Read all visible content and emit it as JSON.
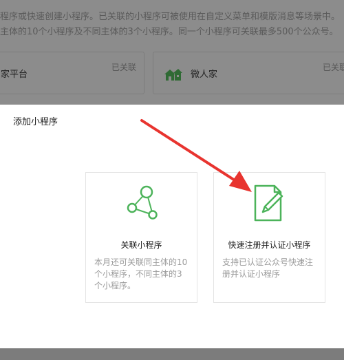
{
  "background": {
    "desc_line1": "程序或快速创建小程序。已关联的小程序可被使用在自定义菜单和模版消息等场景中。",
    "desc_line2": "主体的10个小程序及不同主体的3个小程序。同一个小程序可关联最多500个公众号。",
    "cards": [
      {
        "name": "家平台",
        "status": "已关联",
        "icon": "none"
      },
      {
        "name": "微人家",
        "status": "已关联",
        "icon": "house-icon"
      }
    ]
  },
  "dialog": {
    "title": "添加小程序",
    "options": [
      {
        "icon": "link-nodes-icon",
        "title": "关联小程序",
        "desc_lines": [
          "本月还可关联同主体的10",
          "个小程序，不同主体的3",
          "个小程序。"
        ]
      },
      {
        "icon": "document-edit-icon",
        "title": "快速注册并认证小程序",
        "desc_lines": [
          "支持已认证公众号快速注",
          "册并认证小程序"
        ]
      }
    ]
  },
  "colors": {
    "overlay": "#8c8c8c",
    "accent_green": "#4cb35a",
    "arrow_red": "#e8342f",
    "dialog_bg": "#ffffff"
  }
}
